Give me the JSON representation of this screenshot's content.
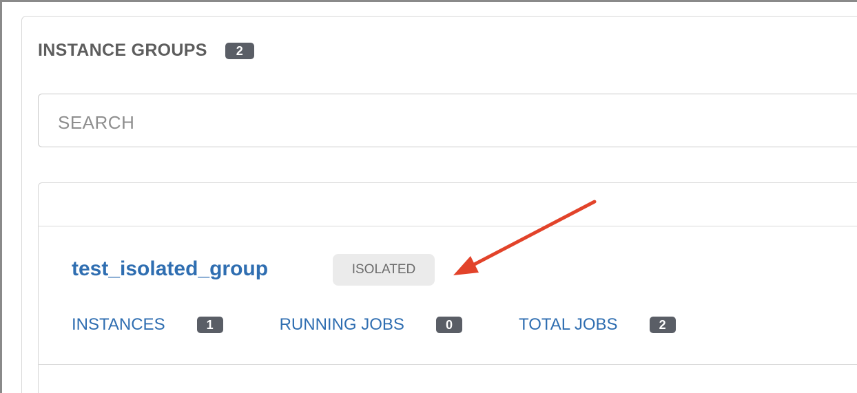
{
  "header": {
    "title": "INSTANCE GROUPS",
    "count": "2"
  },
  "search": {
    "placeholder": "SEARCH",
    "value": ""
  },
  "list": {
    "rows": [
      {
        "name": "test_isolated_group",
        "tag": "ISOLATED",
        "metrics": [
          {
            "label": "INSTANCES",
            "count": "1"
          },
          {
            "label": "RUNNING JOBS",
            "count": "0"
          },
          {
            "label": "TOTAL JOBS",
            "count": "2"
          }
        ]
      }
    ]
  },
  "colors": {
    "link": "#2f6eb1",
    "badge": "#5a5e66",
    "arrow": "#e2432a",
    "tag_bg": "#ebebeb"
  },
  "icons": {
    "annotation": "arrow-annotation-icon"
  }
}
